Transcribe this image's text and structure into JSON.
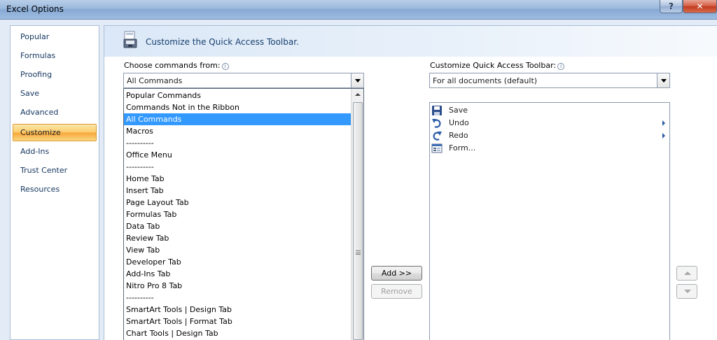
{
  "window": {
    "title": "Excel Options",
    "help_glyph": "?",
    "close_glyph": "✕"
  },
  "nav": {
    "items": [
      "Popular",
      "Formulas",
      "Proofing",
      "Save",
      "Advanced",
      "Customize",
      "Add-Ins",
      "Trust Center",
      "Resources"
    ],
    "selected": "Customize"
  },
  "header": {
    "title": "Customize the Quick Access Toolbar.",
    "icon": "toolbar-customize-icon"
  },
  "left": {
    "label": "Choose commands from:",
    "label_access_key": "C",
    "value": "All Commands",
    "options": [
      "Popular Commands",
      "Commands Not in the Ribbon",
      "All Commands",
      "Macros",
      "----------",
      "Office Menu",
      "----------",
      "Home Tab",
      "Insert Tab",
      "Page Layout Tab",
      "Formulas Tab",
      "Data Tab",
      "Review Tab",
      "View Tab",
      "Developer Tab",
      "Add-Ins Tab",
      "Nitro Pro 8 Tab",
      "----------",
      "SmartArt Tools | Design Tab",
      "SmartArt Tools | Format Tab",
      "Chart Tools | Design Tab"
    ],
    "selected_option": "All Commands"
  },
  "right": {
    "label": "Customize Quick Access Toolbar:",
    "value": "For all documents (default)",
    "items": [
      {
        "label": "Save",
        "icon": "save-icon",
        "submenu": false
      },
      {
        "label": "Undo",
        "icon": "undo-icon",
        "submenu": true
      },
      {
        "label": "Redo",
        "icon": "redo-icon",
        "submenu": true
      },
      {
        "label": "Form...",
        "icon": "form-icon",
        "submenu": false
      }
    ]
  },
  "buttons": {
    "add": "Add >>",
    "remove": "Remove"
  },
  "info_glyph": "i",
  "colors": {
    "selection": "#3399ff",
    "nav_active": "#f7a83d",
    "header_text": "#17406f"
  }
}
